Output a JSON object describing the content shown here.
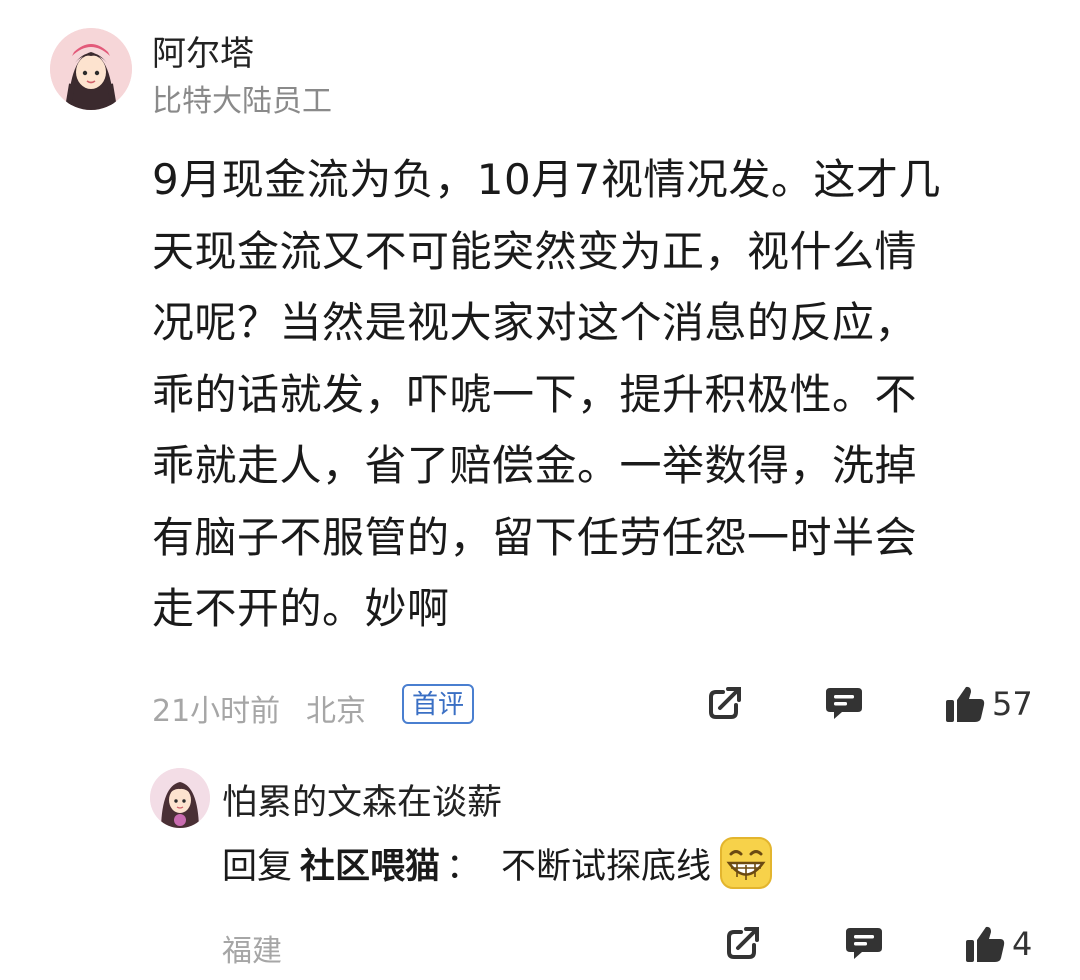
{
  "comment": {
    "username": "阿尔塔",
    "subtitle": "比特大陆员工",
    "lines": [
      "9月现金流为负，10月7视情况发。这才几",
      "天现金流又不可能突然变为正，视什么情",
      "况呢？当然是视大家对这个消息的反应，",
      "乖的话就发，吓唬一下，提升积极性。不",
      "乖就走人，省了赔偿金。一举数得，洗掉",
      "有脑子不服管的，留下任劳任怨一时半会",
      "走不开的。妙啊"
    ],
    "time": "21小时前",
    "location": "北京",
    "badge": "首评",
    "like_count": "57"
  },
  "reply": {
    "username": "怕累的文森在谈薪",
    "prefix": "回复",
    "target": "社区喂猫",
    "colon": "：",
    "text": "不断试探底线",
    "emoji": "grinning-face-emoji",
    "location": "福建",
    "like_count": "4"
  },
  "icons": {
    "share": "share-icon",
    "comment": "comment-icon",
    "like": "thumbs-up-icon"
  },
  "colors": {
    "badge_blue": "#3a6fc4",
    "meta_gray": "#a6a6a6",
    "icon_dark": "#333333"
  }
}
